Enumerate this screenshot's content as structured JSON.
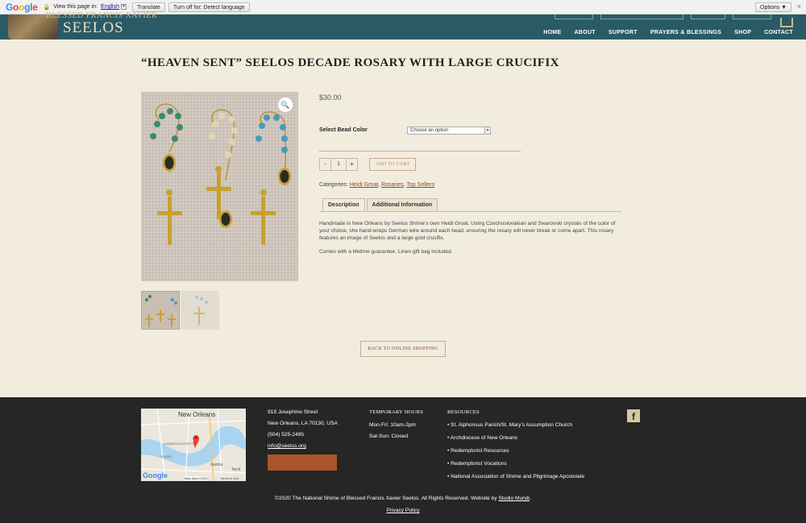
{
  "translate_bar": {
    "logo": "Google",
    "prompt": "View this page in:",
    "language": "English",
    "translate_btn": "Translate",
    "turn_off_btn": "Turn off for: Detect language",
    "options_btn": "Options ▼",
    "close": "×"
  },
  "header": {
    "brand_top": "BLESSED FRANCIS XAVIER",
    "brand": "SEELOS",
    "nav": [
      "HOME",
      "ABOUT",
      "SUPPORT",
      "PRAYERS & BLESSINGS",
      "SHOP",
      "CONTACT"
    ]
  },
  "product": {
    "title": "“HEAVEN SENT” SEELOS DECADE ROSARY WITH LARGE CRUCIFIX",
    "price": "$30.00",
    "variation_label": "Select Bead Color",
    "variation_value": "Choose an option",
    "qty_minus": "-",
    "qty_value": "1",
    "qty_plus": "+",
    "add_to_cart": "ADD TO CART",
    "categories_label": "Categories:",
    "categories": [
      "Heidi Groat",
      "Rosaries",
      "Top Sellers"
    ],
    "tabs": [
      "Description",
      "Additional Information"
    ],
    "description": [
      "Handmade in New Orleans by Seelos Shrine’s own Heidi Groat. Using Czechoslovakian and Swarovski crystals of the color of your choice, she hand-wraps German wire around each bead, ensuring the rosary will never break or come apart. This rosary features an image of Seelos and a large gold crucifix.",
      "Comes with a lifetime guarantee. Linen gift bag included."
    ],
    "back_button": "BACK TO ONLINE SHOPPING"
  },
  "footer": {
    "map": {
      "city": "New Orleans",
      "district": "GARDEN DISTRICT",
      "gretna": "Gretna",
      "touro": "TOURO",
      "terry": "Territ",
      "attrib": "Map data ©2020",
      "terms": "Terms of Use",
      "google": "Google"
    },
    "address": [
      "919 Josephine Street",
      "New Orleans, LA 70130, USA",
      "(504) 525-2495"
    ],
    "email": "info@seelos.org",
    "hours_title": "TEMPORARY HOURS",
    "hours": [
      "Mon-Fri: 10am-2pm",
      "Sat-Sun: Closed"
    ],
    "resources_title": "RESOURCES",
    "resources": [
      "St. Alphonsus Parish/St. Mary’s Assumption Church",
      "Archdiocese of New Orleans",
      "Redemptorist Resources",
      "Redemptorist Vocations",
      "National Association of Shrine and Pilgrimage Apostolate"
    ],
    "facebook": "f",
    "copyright": "©2020 The National Shrine of Blessed Francis Xavier Seelos. All Rights Reserved. Website by",
    "studio": "Studio Mundi",
    "period": ".",
    "privacy": "Privacy Policy"
  },
  "colors": {
    "header": "#2a5a66",
    "page_bg": "#f2ecdf",
    "footer": "#262626",
    "accent": "#8a4a22",
    "donate": "#a8562a"
  }
}
